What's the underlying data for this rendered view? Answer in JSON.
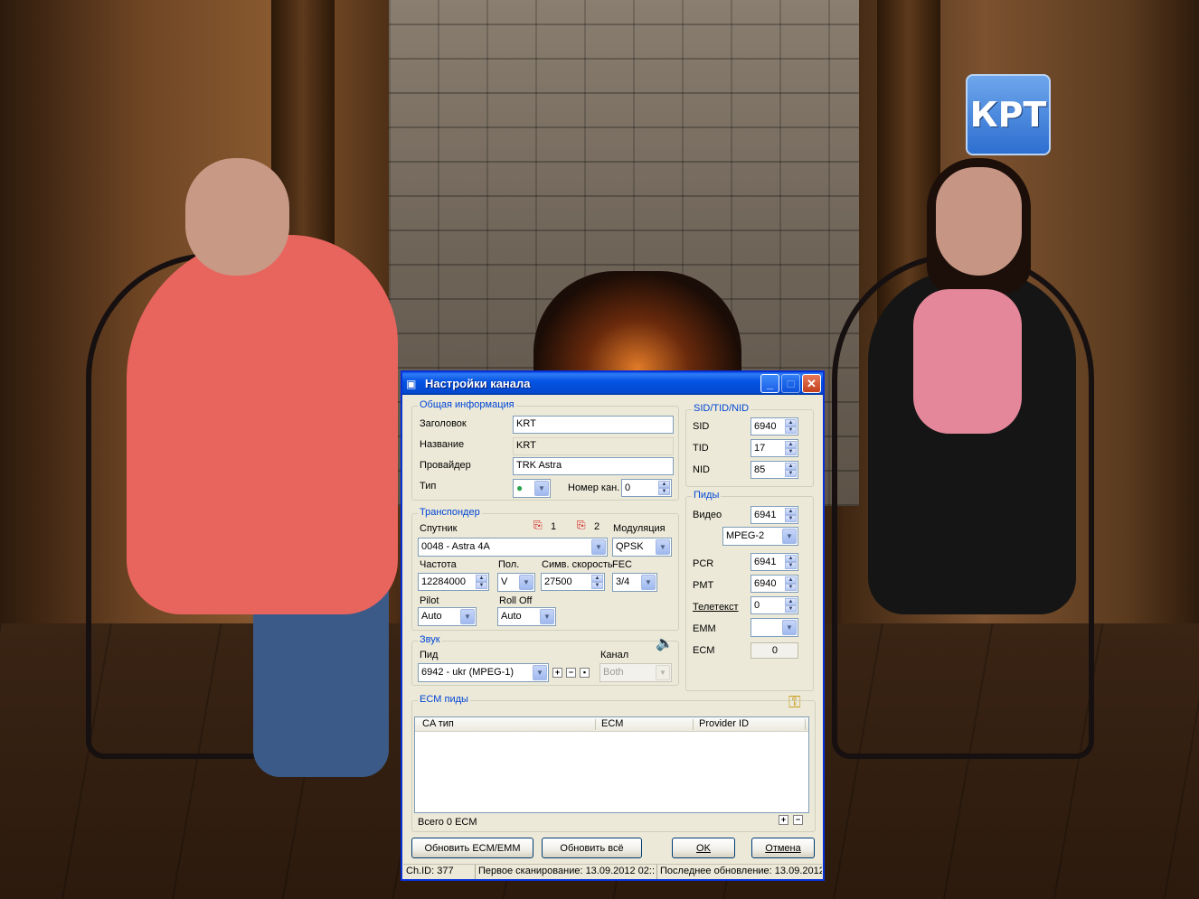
{
  "window": {
    "title": "Настройки канала",
    "minimize": "_",
    "maximize": "□",
    "close": "✕"
  },
  "tv_logo": "КРТ",
  "general": {
    "legend": "Общая информация",
    "title_label": "Заголовок",
    "title_value": "KRT",
    "name_label": "Название",
    "name_value": "KRT",
    "provider_label": "Провайдер",
    "provider_value": "TRK Astra",
    "type_label": "Тип",
    "channel_num_label": "Номер кан.",
    "channel_num_value": "0"
  },
  "transponder": {
    "legend": "Транспондер",
    "satellite_label": "Спутник",
    "lnb1": "1",
    "lnb2": "2",
    "modulation_label": "Модуляция",
    "satellite_value": "0048 - Astra 4A",
    "modulation_value": "QPSK",
    "freq_label": "Частота",
    "pol_label": "Пол.",
    "symrate_label": "Симв. скорость",
    "fec_label": "FEC",
    "freq_value": "12284000",
    "pol_value": "V",
    "symrate_value": "27500",
    "fec_value": "3/4",
    "pilot_label": "Pilot",
    "rolloff_label": "Roll Off",
    "pilot_value": "Auto",
    "rolloff_value": "Auto"
  },
  "audio": {
    "legend": "Звук",
    "pid_label": "Пид",
    "channel_label": "Канал",
    "pid_value": "6942  -  ukr  (MPEG-1)",
    "channel_value": "Both"
  },
  "ids": {
    "legend": "SID/TID/NID",
    "sid_label": "SID",
    "sid_value": "6940",
    "tid_label": "TID",
    "tid_value": "17",
    "nid_label": "NID",
    "nid_value": "85"
  },
  "pids": {
    "legend": "Пиды",
    "video_label": "Видео",
    "video_value": "6941",
    "video_codec": "MPEG-2",
    "pcr_label": "PCR",
    "pcr_value": "6941",
    "pmt_label": "PMT",
    "pmt_value": "6940",
    "teletext_label": "Телетекст",
    "teletext_value": "0",
    "emm_label": "EMM",
    "ecm_label": "ECM",
    "ecm_value": "0"
  },
  "ecm": {
    "legend": "ECM пиды",
    "columns": [
      "CA тип",
      "ECM",
      "Provider ID"
    ],
    "total": "Всего 0 ECM"
  },
  "buttons": {
    "refresh_ecm": "Обновить ECM/EMM",
    "refresh_all": "Обновить всё",
    "ok": "OK",
    "cancel": "Отмена"
  },
  "status": {
    "chid": "Ch.ID: 377",
    "first_scan": "Первое сканирование: 13.09.2012 02::",
    "last_update": "Последнее обновление: 13.09.2012"
  },
  "colors": {
    "title_bar": "#0554e3",
    "legend_text": "#0046d5",
    "window_bg": "#ece9d8"
  }
}
